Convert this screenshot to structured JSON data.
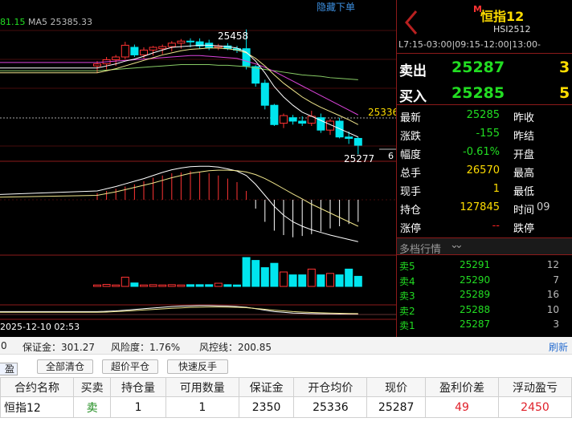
{
  "chart": {
    "ma_text_left": "81.15",
    "ma_text": "MA5 25385.33",
    "hide_order_link": "隐藏下单",
    "high_label": "25458",
    "open_avg_label": "25336",
    "low_label": "25277",
    "side_number": "6",
    "timestamp": "2025-12-10 02:53"
  },
  "colors": {
    "up": "#ff3333",
    "down": "#00e5ee",
    "ma_white": "#ffffff",
    "ma_yellow": "#f0e68c",
    "ma_magenta": "#dd44dd",
    "ma_green": "#88cc66",
    "grid_red": "#8c1a1a",
    "quote_green": "#22dd22",
    "quote_yellow": "#ffdd00",
    "loss_red": "#e0202a"
  },
  "chart_data": {
    "type": "candlestick",
    "candles": [
      {
        "o": 25405,
        "h": 25412,
        "l": 25395,
        "c": 25408
      },
      {
        "o": 25408,
        "h": 25418,
        "l": 25400,
        "c": 25414
      },
      {
        "o": 25414,
        "h": 25421,
        "l": 25405,
        "c": 25418
      },
      {
        "o": 25418,
        "h": 25440,
        "l": 25415,
        "c": 25435
      },
      {
        "o": 25432,
        "h": 25436,
        "l": 25418,
        "c": 25421
      },
      {
        "o": 25421,
        "h": 25432,
        "l": 25416,
        "c": 25428
      },
      {
        "o": 25428,
        "h": 25434,
        "l": 25420,
        "c": 25432
      },
      {
        "o": 25430,
        "h": 25436,
        "l": 25422,
        "c": 25433
      },
      {
        "o": 25433,
        "h": 25441,
        "l": 25426,
        "c": 25438
      },
      {
        "o": 25438,
        "h": 25444,
        "l": 25430,
        "c": 25441
      },
      {
        "o": 25441,
        "h": 25445,
        "l": 25432,
        "c": 25440
      },
      {
        "o": 25440,
        "h": 25445,
        "l": 25430,
        "c": 25434
      },
      {
        "o": 25438,
        "h": 25443,
        "l": 25428,
        "c": 25432
      },
      {
        "o": 25432,
        "h": 25437,
        "l": 25428,
        "c": 25434
      },
      {
        "o": 25434,
        "h": 25438,
        "l": 25428,
        "c": 25430
      },
      {
        "o": 25430,
        "h": 25434,
        "l": 25424,
        "c": 25428
      },
      {
        "o": 25430,
        "h": 25458,
        "l": 25400,
        "c": 25405
      },
      {
        "o": 25404,
        "h": 25406,
        "l": 25375,
        "c": 25380
      },
      {
        "o": 25380,
        "h": 25385,
        "l": 25342,
        "c": 25348
      },
      {
        "o": 25348,
        "h": 25350,
        "l": 25318,
        "c": 25320
      },
      {
        "o": 25322,
        "h": 25336,
        "l": 25315,
        "c": 25333
      },
      {
        "o": 25330,
        "h": 25334,
        "l": 25320,
        "c": 25325
      },
      {
        "o": 25325,
        "h": 25332,
        "l": 25318,
        "c": 25322
      },
      {
        "o": 25322,
        "h": 25340,
        "l": 25318,
        "c": 25332
      },
      {
        "o": 25330,
        "h": 25336,
        "l": 25308,
        "c": 25312
      },
      {
        "o": 25312,
        "h": 25328,
        "l": 25305,
        "c": 25325
      },
      {
        "o": 25325,
        "h": 25330,
        "l": 25300,
        "c": 25302
      },
      {
        "o": 25302,
        "h": 25310,
        "l": 25292,
        "c": 25300
      },
      {
        "o": 25300,
        "h": 25302,
        "l": 25277,
        "c": 25290
      }
    ],
    "ma_white": [
      25402,
      25405,
      25408,
      25412,
      25415,
      25419,
      25424,
      25428,
      25432,
      25433,
      25434,
      25435,
      25435,
      25434,
      25433,
      25431,
      25425,
      25412,
      25395,
      25375,
      25360,
      25348,
      25338,
      25332,
      25326,
      25320,
      25314,
      25308,
      25302
    ],
    "ma_yellow": [
      25395,
      25398,
      25401,
      25405,
      25409,
      25413,
      25417,
      25421,
      25424,
      25427,
      25429,
      25430,
      25431,
      25431,
      25430,
      25428,
      25424,
      25416,
      25405,
      25392,
      25380,
      25370,
      25360,
      25352,
      25345,
      25339,
      25333,
      25327,
      25320
    ],
    "ma_magenta": [
      25410,
      25411,
      25412,
      25413,
      25414,
      25415,
      25416,
      25417,
      25418,
      25419,
      25420,
      25420,
      25419,
      25418,
      25417,
      25416,
      25412,
      25408,
      25403,
      25397,
      25390,
      25383,
      25376,
      25369,
      25362,
      25355,
      25348,
      25341,
      25334
    ],
    "ma_green": [
      25398,
      25399,
      25400,
      25401,
      25402,
      25403,
      25404,
      25405,
      25406,
      25407,
      25407,
      25407,
      25407,
      25406,
      25406,
      25405,
      25404,
      25402,
      25400,
      25398,
      25396,
      25394,
      25392,
      25391,
      25390,
      25388,
      25387,
      25386,
      25385
    ],
    "ylim": [
      25268,
      25475
    ],
    "macd_hist": [
      0.15,
      0.2,
      0.25,
      0.3,
      0.35,
      0.42,
      0.5,
      0.55,
      0.6,
      0.62,
      0.65,
      0.63,
      0.6,
      0.55,
      0.48,
      0.4,
      0.2,
      -0.2,
      -0.5,
      -0.7,
      -0.8,
      -0.85,
      -0.82,
      -0.78,
      -0.72,
      -0.65,
      -0.6,
      -0.55,
      -0.5
    ],
    "macd_line1": [
      0.2,
      0.25,
      0.3,
      0.36,
      0.42,
      0.48,
      0.55,
      0.62,
      0.68,
      0.72,
      0.75,
      0.76,
      0.76,
      0.74,
      0.7,
      0.65,
      0.55,
      0.35,
      0.1,
      -0.15,
      -0.35,
      -0.5,
      -0.6,
      -0.68,
      -0.74,
      -0.8,
      -0.85,
      -0.9,
      -0.95
    ],
    "macd_line2": [
      0.1,
      0.14,
      0.18,
      0.23,
      0.28,
      0.33,
      0.38,
      0.44,
      0.5,
      0.55,
      0.6,
      0.63,
      0.66,
      0.67,
      0.67,
      0.66,
      0.63,
      0.57,
      0.48,
      0.37,
      0.25,
      0.13,
      0.02,
      -0.1,
      -0.2,
      -0.3,
      -0.4,
      -0.5,
      -0.6
    ],
    "volume": [
      0,
      0,
      0,
      0,
      0,
      3,
      0,
      0,
      0,
      0,
      0,
      0,
      0,
      0,
      0,
      0,
      0,
      10,
      9,
      6,
      8,
      5,
      4,
      4,
      6,
      4,
      4,
      5,
      4
    ],
    "vol_up": [
      false,
      false,
      false,
      false,
      false,
      false,
      false,
      false,
      false,
      false,
      false,
      false,
      false,
      false,
      false,
      false,
      false,
      false,
      false,
      false,
      true,
      false,
      false,
      true,
      false,
      true,
      false,
      true,
      false
    ],
    "vol_real": [
      0.5,
      0.7,
      0.5,
      3.2,
      1.2,
      0.5,
      0.6,
      0.5,
      0.6,
      0.5,
      0.6,
      0.6,
      0.6,
      1.1,
      0.6,
      0.5,
      10,
      9,
      6.5,
      8,
      5,
      4,
      4,
      6,
      4,
      4.5,
      4,
      6,
      3.5
    ],
    "osc_line1": [
      0.2,
      0.22,
      0.25,
      0.3,
      0.35,
      0.4,
      0.45,
      0.5,
      0.55,
      0.58,
      0.6,
      0.62,
      0.62,
      0.6,
      0.58,
      0.55,
      0.5,
      0.4,
      0.3,
      0.2,
      0.15,
      0.1,
      0.08,
      0.06,
      0.05,
      0.04,
      0.03,
      0.02,
      0.02
    ],
    "osc_line2": [
      0.15,
      0.17,
      0.2,
      0.23,
      0.27,
      0.31,
      0.35,
      0.39,
      0.43,
      0.46,
      0.49,
      0.51,
      0.52,
      0.52,
      0.51,
      0.5,
      0.47,
      0.42,
      0.36,
      0.3,
      0.25,
      0.2,
      0.17,
      0.14,
      0.12,
      0.1,
      0.08,
      0.07,
      0.06
    ]
  },
  "panel": {
    "back_icon": "chevron-left-icon",
    "m_badge": "M",
    "title": "恒指12",
    "code": "HSI2512",
    "sessions": "L7:15-03:00|09:15-12:00|13:00-",
    "sell_label": "卖出",
    "sell_price": "25287",
    "sell_vol": "3",
    "buy_label": "买入",
    "buy_price": "25285",
    "buy_vol": "5",
    "quotes": [
      {
        "label": "最新",
        "value": "25285",
        "label2": "昨收",
        "cls": "green"
      },
      {
        "label": "涨跌",
        "value": "-155",
        "label2": "昨结",
        "cls": "green"
      },
      {
        "label": "幅度",
        "value": "-0.61%",
        "label2": "开盘",
        "cls": "green"
      },
      {
        "label": "总手",
        "value": "26570",
        "label2": "最高",
        "cls": "yellow"
      },
      {
        "label": "现手",
        "value": "1",
        "label2": "最低",
        "cls": "yellow"
      },
      {
        "label": "持仓",
        "value": "127845",
        "label2": "时间",
        "value2": "09",
        "cls": "yellow"
      },
      {
        "label": "涨停",
        "value": "--",
        "label2": "跌停",
        "cls": "red"
      }
    ],
    "depth_label": "多档行情",
    "depth_icon": "double-chevron-down-icon",
    "orderbook": [
      {
        "label": "卖5",
        "price": "25291",
        "vol": "12"
      },
      {
        "label": "卖4",
        "price": "25290",
        "vol": "7"
      },
      {
        "label": "卖3",
        "price": "25289",
        "vol": "16"
      },
      {
        "label": "卖2",
        "price": "25288",
        "vol": "10"
      },
      {
        "label": "卖1",
        "price": "25287",
        "vol": "3"
      }
    ]
  },
  "account": {
    "balance_tail": "0",
    "margin": "保证金：301.27",
    "risk": "风险度：1.76%",
    "risk_line": "风控线：200.85",
    "refresh": "刷新"
  },
  "toolbar": {
    "tab": "盈",
    "close_all": "全部清仓",
    "over_close": "超价平仓",
    "quick_reverse": "快速反手"
  },
  "positions": {
    "headers": [
      "合约名称",
      "买卖",
      "持仓量",
      "可用数量",
      "保证金",
      "开仓均价",
      "现价",
      "盈利价差",
      "浮动盈亏"
    ],
    "rows": [
      [
        "恒指12",
        "卖",
        "1",
        "1",
        "2350",
        "25336",
        "25287",
        "49",
        "2450"
      ]
    ]
  }
}
